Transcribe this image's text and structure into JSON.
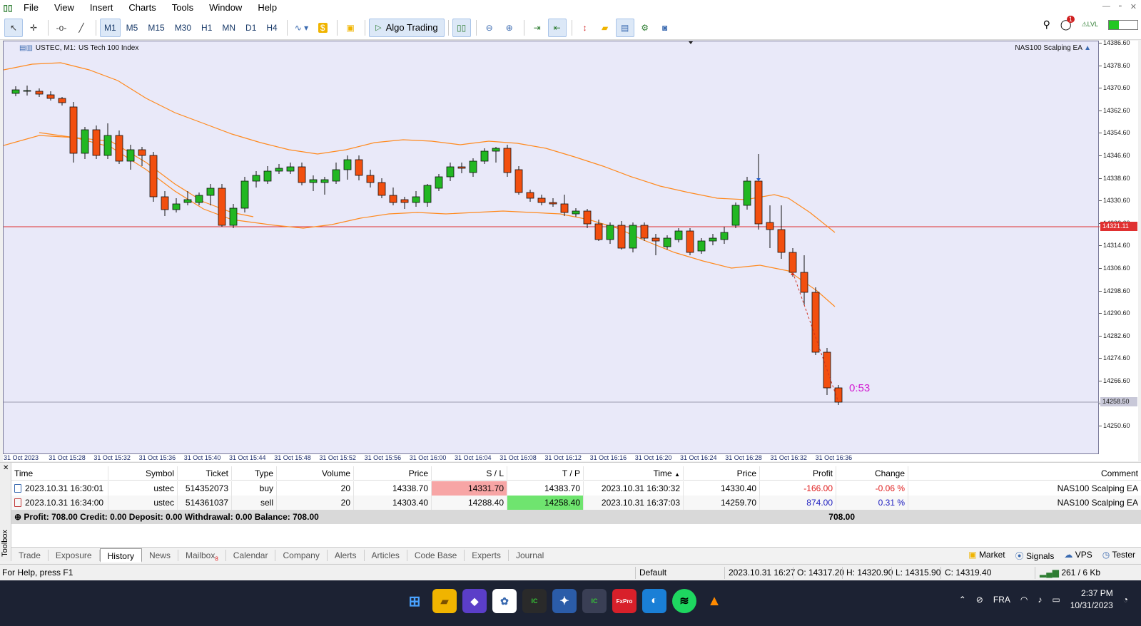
{
  "menu": {
    "items": [
      "File",
      "View",
      "Insert",
      "Charts",
      "Tools",
      "Window",
      "Help"
    ]
  },
  "toolbar": {
    "timeframes": [
      "M1",
      "M5",
      "M15",
      "M30",
      "H1",
      "MN",
      "D1",
      "H4"
    ],
    "selected_timeframe": "M1",
    "algo_label": "Algo Trading",
    "notification_count": "1",
    "lvl_label": "LVL"
  },
  "chart": {
    "symbol": "USTEC, M1:",
    "description": "US Tech 100 Index",
    "ea_name": "NAS100 Scalping EA",
    "countdown": "0:53",
    "price_labels": [
      "14386.60",
      "14378.60",
      "14370.60",
      "14362.60",
      "14354.60",
      "14346.60",
      "14338.60",
      "14330.60",
      "14322.60",
      "14314.60",
      "14306.60",
      "14298.60",
      "14290.60",
      "14282.60",
      "14274.60",
      "14266.60",
      "14258.60",
      "14250.60"
    ],
    "current_price_tag": "14321.11",
    "bid_tag": "14258.50",
    "time_labels": [
      "31 Oct 2023",
      "31 Oct 15:28",
      "31 Oct 15:32",
      "31 Oct 15:36",
      "31 Oct 15:40",
      "31 Oct 15:44",
      "31 Oct 15:48",
      "31 Oct 15:52",
      "31 Oct 15:56",
      "31 Oct 16:00",
      "31 Oct 16:04",
      "31 Oct 16:08",
      "31 Oct 16:12",
      "31 Oct 16:16",
      "31 Oct 16:20",
      "31 Oct 16:24",
      "31 Oct 16:28",
      "31 Oct 16:32",
      "31 Oct 16:36"
    ],
    "colors": {
      "bull": "#22b722",
      "bear": "#f24f0f",
      "band": "#ff8a1f",
      "hline": "#e03030",
      "background": "#e9e9f9"
    }
  },
  "table": {
    "headers": [
      "Time",
      "Symbol",
      "Ticket",
      "Type",
      "Volume",
      "Price",
      "S / L",
      "T / P",
      "Time",
      "Price",
      "Profit",
      "Change",
      "Comment"
    ],
    "rows": [
      [
        "2023.10.31 16:30:01",
        "ustec",
        "514352073",
        "buy",
        "20",
        "14338.70",
        "14331.70",
        "14383.70",
        "2023.10.31 16:30:32",
        "14330.40",
        "-166.00",
        "-0.06 %",
        "NAS100 Scalping EA"
      ],
      [
        "2023.10.31 16:34:00",
        "ustec",
        "514361037",
        "sell",
        "20",
        "14303.40",
        "14288.40",
        "14258.40",
        "2023.10.31 16:37:03",
        "14259.70",
        "874.00",
        "0.31 %",
        "NAS100 Scalping EA"
      ]
    ],
    "summary": "Profit: 708.00  Credit: 0.00  Deposit: 0.00  Withdrawal: 0.00  Balance: 708.00",
    "summary_total": "708.00",
    "toolbox_label": "Toolbox"
  },
  "tabs": {
    "items": [
      "Trade",
      "Exposure",
      "History",
      "News",
      "Mailbox",
      "Calendar",
      "Company",
      "Alerts",
      "Articles",
      "Code Base",
      "Experts",
      "Journal"
    ],
    "active": "History",
    "mailbox_count": "8",
    "right": [
      "Market",
      "Signals",
      "VPS",
      "Tester"
    ]
  },
  "status": {
    "help": "For Help, press F1",
    "profile": "Default",
    "datetime": "2023.10.31 16:27",
    "open": "O: 14317.20",
    "high": "H: 14320.90",
    "low": "L: 14315.90",
    "close": "C: 14319.40",
    "traffic": "261 / 6 Kb"
  },
  "taskbar": {
    "lang": "FRA",
    "time": "2:37 PM",
    "date": "10/31/2023"
  }
}
